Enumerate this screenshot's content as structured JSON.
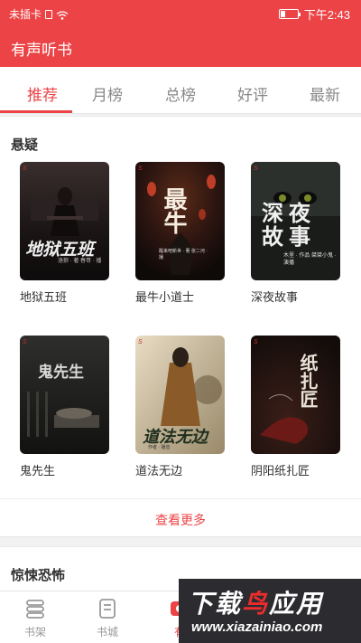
{
  "status_bar": {
    "carrier": "未插卡",
    "time": "下午2:43",
    "battery_level": 0.3
  },
  "app_bar": {
    "title": "有声听书"
  },
  "tabs": [
    {
      "label": "推荐",
      "active": true
    },
    {
      "label": "月榜"
    },
    {
      "label": "总榜"
    },
    {
      "label": "好评"
    },
    {
      "label": "最新"
    }
  ],
  "sections": [
    {
      "title": "悬疑",
      "books": [
        {
          "name": "地狱五班",
          "cover_text": "地狱五班",
          "cover_sub": "洛狼 · 著  春哥 · 播"
        },
        {
          "name": "最牛小道士",
          "cover_text": "最牛",
          "cover_sub": "醒来吧新世 · 著  张二河 · 播"
        },
        {
          "name": "深夜故事",
          "cover_text": "深夜故事",
          "cover_sub": "木里 · 作品  桀桀小鬼 · 演播"
        },
        {
          "name": "鬼先生",
          "cover_text": "鬼先生",
          "cover_sub": ""
        },
        {
          "name": "道法无边",
          "cover_text": "道法无边",
          "cover_sub": "作者 · 播音"
        },
        {
          "name": "阴阳纸扎匠",
          "cover_text": "纸扎匠",
          "cover_sub": ""
        }
      ],
      "more_label": "查看更多"
    },
    {
      "title": "惊悚恐怖"
    }
  ],
  "bottom_nav": [
    {
      "label": "书架",
      "icon": "bookshelf-icon"
    },
    {
      "label": "书城",
      "icon": "bookstore-icon"
    },
    {
      "label": "有",
      "icon": "audio-icon",
      "active": true
    }
  ],
  "watermark": {
    "text_white": "下载",
    "text_red": "鸟",
    "text_white2": "应用",
    "url": "www.xiazainiao.com"
  },
  "colors": {
    "accent": "#ec4446",
    "text": "#333333",
    "muted": "#999999"
  }
}
